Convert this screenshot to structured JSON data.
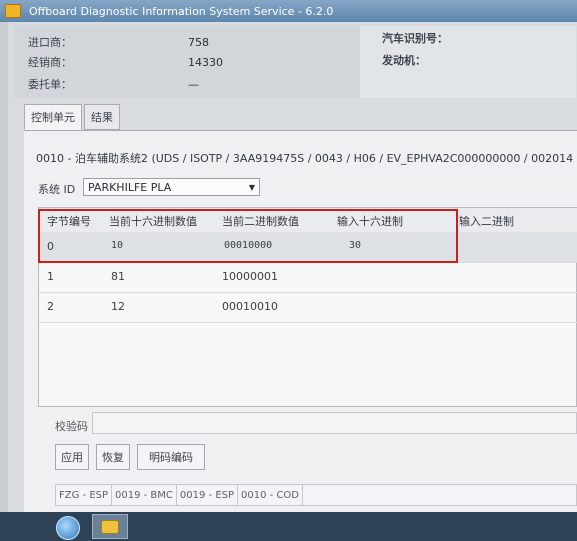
{
  "window": {
    "title": "Offboard Diagnostic Information System Service - 6.2.0"
  },
  "info": {
    "importer_label": "进口商：",
    "importer_value": "758",
    "dealer_label": "经销商：",
    "dealer_value": "14330",
    "order_label": "委托单：",
    "order_value": "—",
    "vin_label": "汽车识别号：",
    "engine_label": "发动机："
  },
  "tabs": [
    {
      "label": "控制单元",
      "active": true
    },
    {
      "label": "结果",
      "active": false
    }
  ],
  "ecu_line": "0010 - 泊车辅助系统2 (UDS / ISOTP / 3AA919475S / 0043 / H06 / EV_EPHVA2C000000000 / 002014",
  "system_id": {
    "label": "系统 ID",
    "value": "PARKHILFE PLA"
  },
  "table": {
    "headers": [
      "字节编号",
      "当前十六进制数值",
      "当前二进制数值",
      "输入十六进制",
      "输入二进制"
    ],
    "rows": [
      [
        "0",
        "10",
        "00010000",
        "30",
        ""
      ],
      [
        "1",
        "81",
        "10000001",
        "",
        ""
      ],
      [
        "2",
        "12",
        "00010010",
        "",
        ""
      ]
    ]
  },
  "checksum_label": "校验码",
  "buttons": {
    "apply": "应用",
    "restore": "恢复",
    "plaintext": "明码编码"
  },
  "codes": [
    "FZG - ESP",
    "0019 - BMC",
    "0019 - ESP",
    "0010 - COD"
  ],
  "colors": {
    "highlight": "#d11c1c",
    "titlebar": "#5f86ad"
  }
}
